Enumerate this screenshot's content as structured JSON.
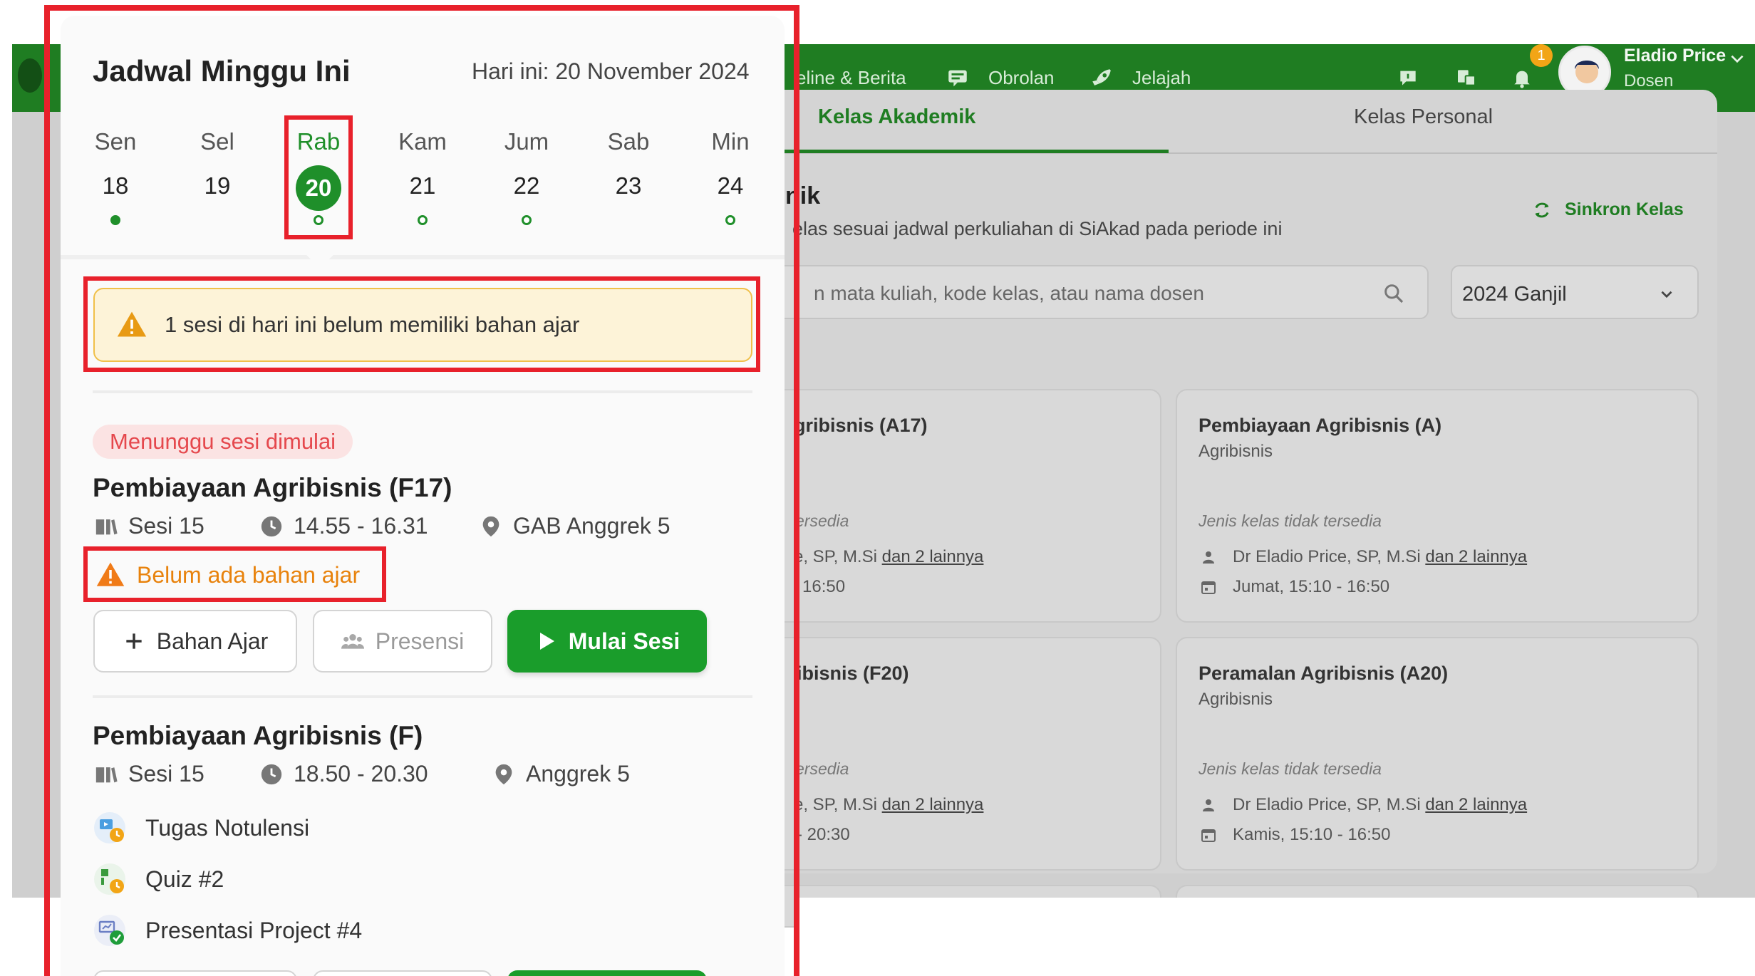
{
  "background": {
    "nav": [
      {
        "label": "eline & Berita",
        "icon": "newspaper-icon"
      },
      {
        "label": "Obrolan",
        "icon": "chat-icon"
      },
      {
        "label": "Jelajah",
        "icon": "rocket-icon"
      }
    ],
    "notification_count": "1",
    "user": {
      "name": "Eladio Price",
      "role": "Dosen"
    },
    "tabs": [
      "Kelas Akademik",
      "Kelas Personal"
    ],
    "section_title": "nik",
    "section_desc": "elas sesuai jadwal perkuliahan di SiAkad pada periode ini",
    "sync_label": "Sinkron Kelas",
    "search_placeholder": "n mata kuliah, kode kelas, atau nama dosen",
    "period": "2024 Ganjil",
    "cards": [
      {
        "title": "gribisnis (A17)",
        "type": "ersedia",
        "lecturer": "e, SP, M.Si",
        "more": "dan 2 lainnya",
        "time": "16:50"
      },
      {
        "title": "Pembiayaan Agribisnis (A)",
        "sub": "Agribisnis",
        "type": "Jenis kelas tidak tersedia",
        "lecturer": "Dr Eladio Price, SP, M.Si",
        "more": "dan 2 lainnya",
        "time": "Jumat, 15:10 - 16:50"
      },
      {
        "title": "ibisnis (F20)",
        "type": "ersedia",
        "lecturer": "e, SP, M.Si",
        "more": "dan 2 lainnya",
        "time": "- 20:30"
      },
      {
        "title": "Peramalan Agribisnis (A20)",
        "sub": "Agribisnis",
        "type": "Jenis kelas tidak tersedia",
        "lecturer": "Dr Eladio Price, SP, M.Si",
        "more": "dan 2 lainnya",
        "time": "Kamis, 15:10 - 16:50"
      }
    ]
  },
  "panel": {
    "title": "Jadwal Minggu Ini",
    "today": "Hari ini: 20 November 2024",
    "days": [
      {
        "name": "Sen",
        "num": "18",
        "marker": "filled"
      },
      {
        "name": "Sel",
        "num": "19",
        "marker": "none"
      },
      {
        "name": "Rab",
        "num": "20",
        "marker": "ring",
        "selected": true
      },
      {
        "name": "Kam",
        "num": "21",
        "marker": "ring"
      },
      {
        "name": "Jum",
        "num": "22",
        "marker": "ring"
      },
      {
        "name": "Sab",
        "num": "23",
        "marker": "none"
      },
      {
        "name": "Min",
        "num": "24",
        "marker": "ring"
      }
    ],
    "warning": "1 sesi di hari ini belum memiliki bahan ajar",
    "sessions": [
      {
        "status": "Menunggu sesi dimulai",
        "title": "Pembiayaan Agribisnis (F17)",
        "sesi": "Sesi 15",
        "time": "14.55 - 16.31",
        "room": "GAB Anggrek 5",
        "no_material": "Belum ada bahan ajar",
        "buttons": {
          "material": "Bahan Ajar",
          "attendance": "Presensi",
          "start": "Mulai Sesi"
        }
      },
      {
        "title": "Pembiayaan Agribisnis (F)",
        "sesi": "Sesi 15",
        "time": "18.50 - 20.30",
        "room": "Anggrek 5",
        "tasks": [
          "Tugas Notulensi",
          "Quiz #2",
          "Presentasi Project #4"
        ]
      }
    ]
  },
  "colors": {
    "brand_green": "#1f7d22",
    "highlight_red": "#e8212b",
    "warning_orange": "#e8820c"
  }
}
